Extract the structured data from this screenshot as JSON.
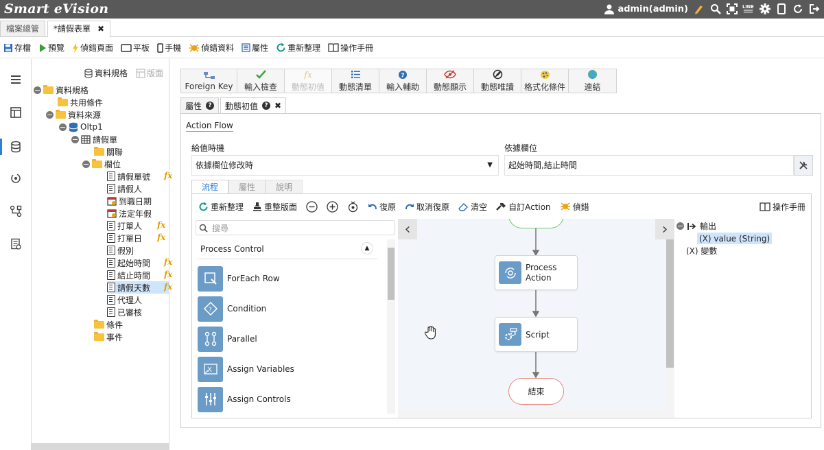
{
  "app": {
    "brand": "Smart eVision",
    "user": "admin(admin)"
  },
  "file_tabs": [
    {
      "label": "檔案總管"
    },
    {
      "label": "*請假表單",
      "close": "✖"
    }
  ],
  "toolbar": {
    "save": "存檔",
    "preview": "預覽",
    "debug_page": "偵錯頁面",
    "tablet": "平板",
    "phone": "手機",
    "debug_data": "偵錯資料",
    "properties": "屬性",
    "reorganize": "重新整理",
    "manual": "操作手冊"
  },
  "tree_header": {
    "data_spec": "資料規格",
    "layout": "版面"
  },
  "tree": {
    "root": "資料規格",
    "common": "共用條件",
    "source": "資料來源",
    "oltp": "Oltp1",
    "table": "請假單",
    "relation": "關聯",
    "fields": "欄位",
    "field_items": [
      "請假單號",
      "請假人",
      "到職日期",
      "法定年假",
      "打單人",
      "打單日",
      "假別",
      "起始時間",
      "結止時間",
      "請假天數",
      "代理人",
      "已審核"
    ],
    "conditions": "條件",
    "events": "事件"
  },
  "prop_toolbar": [
    "Foreign Key",
    "輸入檢查",
    "動態初值",
    "動態清單",
    "輸入輔助",
    "動態顯示",
    "動態唯讀",
    "格式化條件",
    "連結"
  ],
  "sub_tabs": [
    {
      "label": "屬性"
    },
    {
      "label": "動態初值",
      "close": "✖"
    }
  ],
  "action_flow": {
    "title": "Action Flow",
    "timing_label": "給值時機",
    "timing_value": "依據欄位修改時",
    "basis_label": "依據欄位",
    "basis_value": "起始時間,結止時間"
  },
  "inner_tabs": [
    "流程",
    "屬性",
    "說明"
  ],
  "flow_toolbar": {
    "reorganize": "重新整理",
    "relayout": "重整版面",
    "undo": "復原",
    "redo": "取消復原",
    "clear": "清空",
    "custom_action": "自訂Action",
    "debug": "偵錯",
    "manual": "操作手冊"
  },
  "palette": {
    "search_placeholder": "搜尋",
    "category": "Process Control",
    "items": [
      "ForEach Row",
      "Condition",
      "Parallel",
      "Assign Variables",
      "Assign Controls"
    ]
  },
  "canvas": {
    "process_action": [
      "Process",
      "Action"
    ],
    "script": "Script",
    "end": "結束"
  },
  "vars": {
    "output": "輸出",
    "output_value": "(X) value (String)",
    "variables": "(X) 變數"
  },
  "colors": {
    "topbar": "#595959",
    "accent": "#2f7fd6",
    "node_icon": "#6b9bc7",
    "end_border": "#e8847b",
    "start_border": "#6cc56c"
  }
}
